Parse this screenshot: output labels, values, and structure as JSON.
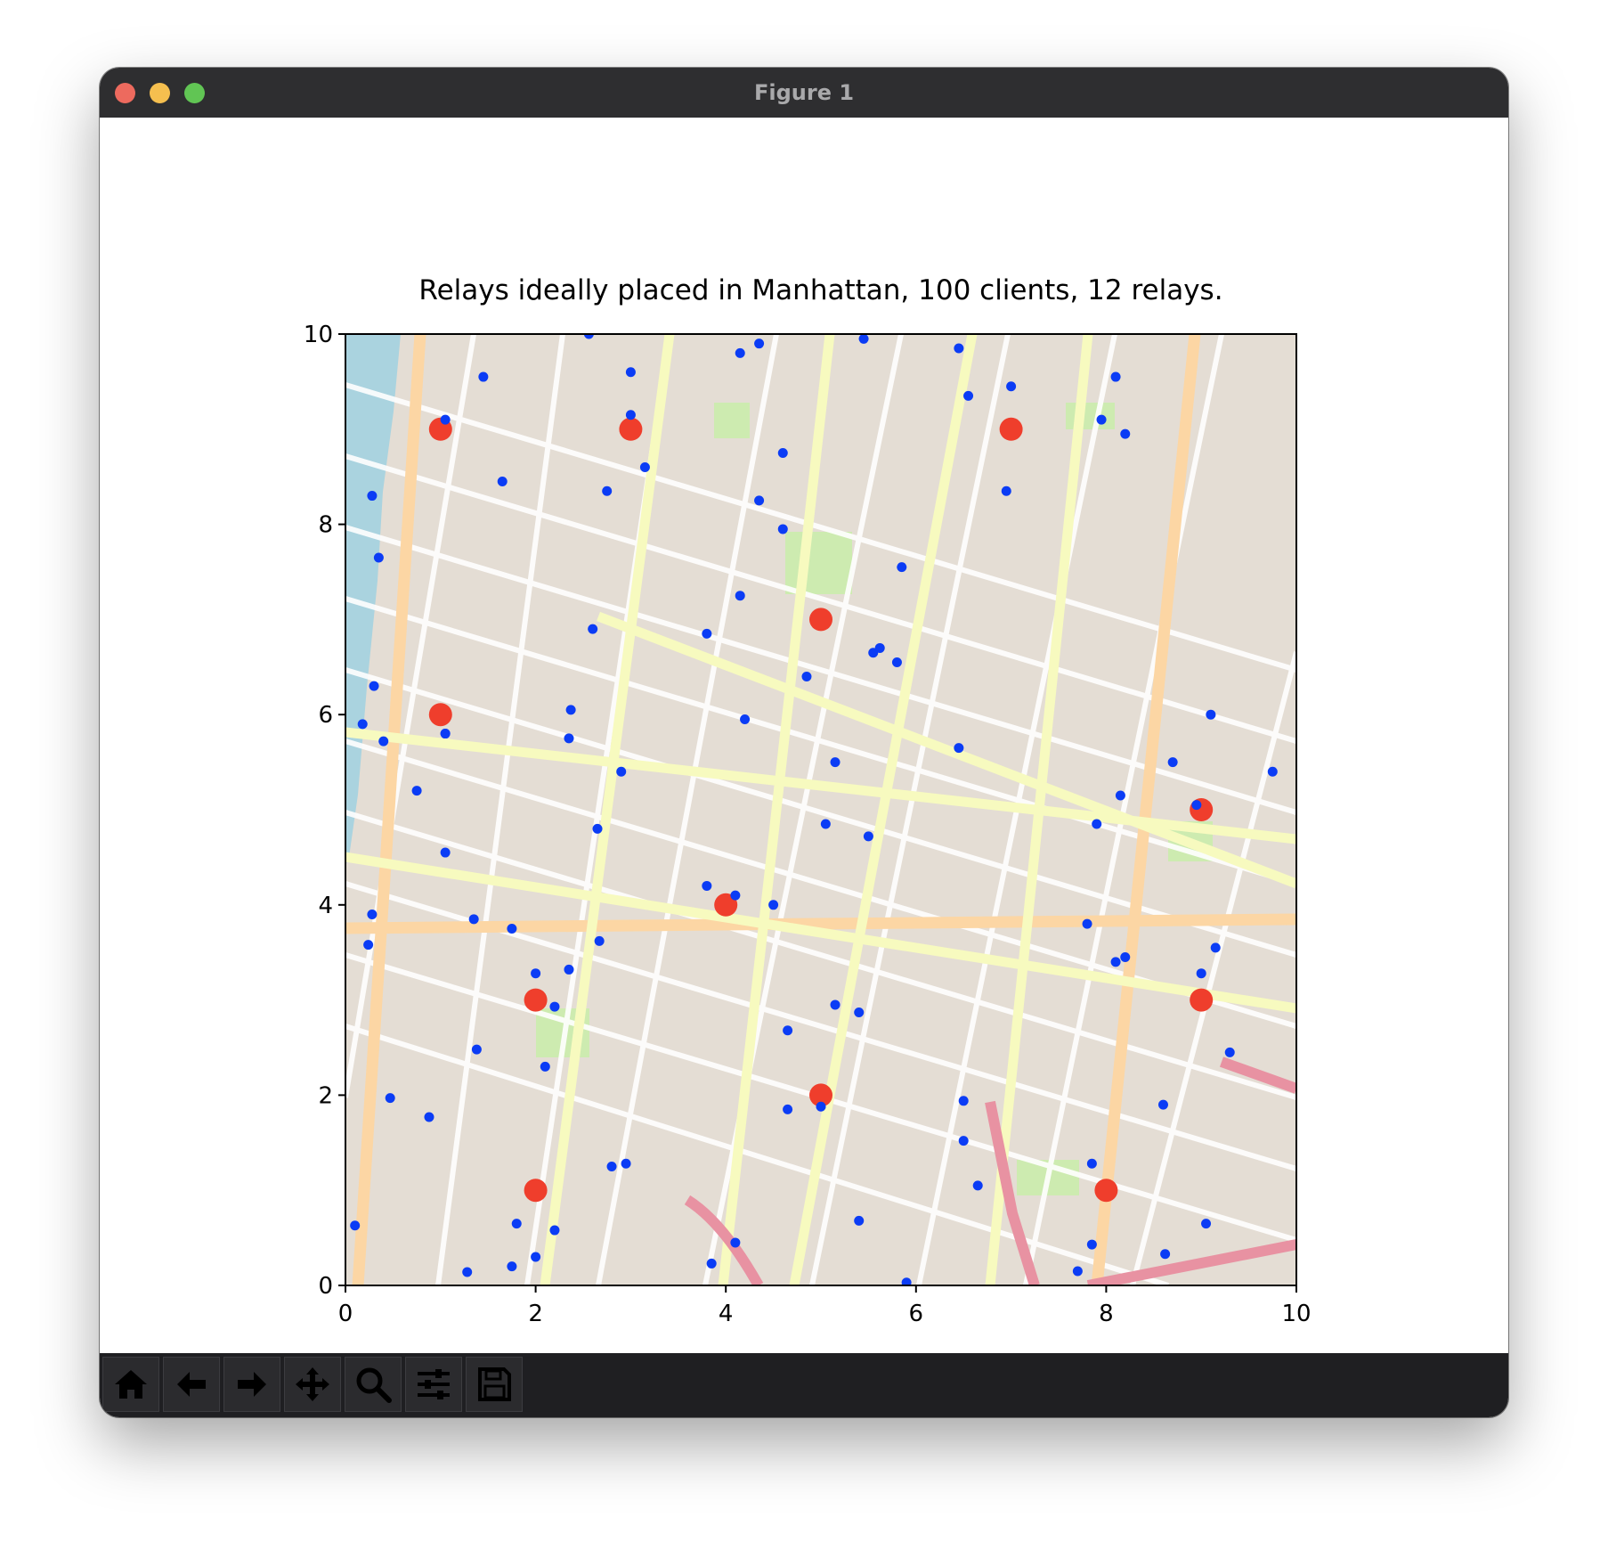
{
  "window": {
    "title": "Figure 1"
  },
  "toolbar": {
    "buttons": [
      {
        "name": "home-button",
        "icon": "home-icon"
      },
      {
        "name": "back-button",
        "icon": "arrow-left-icon"
      },
      {
        "name": "forward-button",
        "icon": "arrow-right-icon"
      },
      {
        "name": "pan-button",
        "icon": "move-icon"
      },
      {
        "name": "zoom-button",
        "icon": "magnifier-icon"
      },
      {
        "name": "configure-subplots-button",
        "icon": "sliders-icon"
      },
      {
        "name": "save-button",
        "icon": "floppy-disk-icon"
      }
    ]
  },
  "chart_data": {
    "type": "scatter",
    "title": "Relays ideally placed in Manhattan, 100 clients, 12 relays.",
    "xlabel": "",
    "ylabel": "",
    "xlim": [
      0,
      10
    ],
    "ylim": [
      0,
      10
    ],
    "xticks": [
      "0",
      "2",
      "4",
      "6",
      "8",
      "10"
    ],
    "yticks": [
      "0",
      "2",
      "4",
      "6",
      "8",
      "10"
    ],
    "grid": false,
    "background": "street map of lower Manhattan",
    "series": [
      {
        "color": "#0b3cf5",
        "marker_size": "small",
        "points": [
          [
            2.56,
            10.0
          ],
          [
            3.0,
            9.6
          ],
          [
            1.45,
            9.55
          ],
          [
            4.15,
            9.8
          ],
          [
            4.35,
            9.9
          ],
          [
            5.45,
            9.95
          ],
          [
            6.45,
            9.85
          ],
          [
            7.0,
            9.45
          ],
          [
            8.1,
            9.55
          ],
          [
            6.55,
            9.35
          ],
          [
            1.05,
            9.1
          ],
          [
            3.0,
            9.15
          ],
          [
            7.95,
            9.1
          ],
          [
            8.2,
            8.95
          ],
          [
            4.6,
            8.75
          ],
          [
            3.15,
            8.6
          ],
          [
            1.65,
            8.45
          ],
          [
            2.75,
            8.35
          ],
          [
            6.95,
            8.35
          ],
          [
            0.28,
            8.3
          ],
          [
            4.35,
            8.25
          ],
          [
            4.6,
            7.95
          ],
          [
            5.85,
            7.55
          ],
          [
            0.35,
            7.65
          ],
          [
            4.15,
            7.25
          ],
          [
            2.6,
            6.9
          ],
          [
            3.8,
            6.85
          ],
          [
            5.55,
            6.65
          ],
          [
            5.62,
            6.7
          ],
          [
            5.8,
            6.55
          ],
          [
            4.85,
            6.4
          ],
          [
            0.3,
            6.3
          ],
          [
            0.18,
            5.9
          ],
          [
            1.05,
            5.8
          ],
          [
            4.2,
            5.95
          ],
          [
            2.37,
            6.05
          ],
          [
            2.35,
            5.75
          ],
          [
            0.4,
            5.72
          ],
          [
            6.45,
            5.65
          ],
          [
            5.15,
            5.5
          ],
          [
            2.9,
            5.4
          ],
          [
            9.1,
            6.0
          ],
          [
            9.75,
            5.4
          ],
          [
            8.7,
            5.5
          ],
          [
            8.15,
            5.15
          ],
          [
            0.75,
            5.2
          ],
          [
            8.95,
            5.05
          ],
          [
            5.05,
            4.85
          ],
          [
            5.5,
            4.72
          ],
          [
            2.65,
            4.8
          ],
          [
            1.05,
            4.55
          ],
          [
            7.9,
            4.85
          ],
          [
            3.8,
            4.2
          ],
          [
            4.1,
            4.1
          ],
          [
            4.5,
            4.0
          ],
          [
            0.28,
            3.9
          ],
          [
            1.35,
            3.85
          ],
          [
            1.75,
            3.75
          ],
          [
            7.8,
            3.8
          ],
          [
            0.24,
            3.58
          ],
          [
            2.67,
            3.62
          ],
          [
            9.15,
            3.55
          ],
          [
            8.1,
            3.4
          ],
          [
            8.2,
            3.45
          ],
          [
            2.0,
            3.28
          ],
          [
            2.35,
            3.32
          ],
          [
            9.0,
            3.28
          ],
          [
            2.2,
            2.93
          ],
          [
            5.15,
            2.95
          ],
          [
            5.4,
            2.87
          ],
          [
            4.65,
            2.68
          ],
          [
            1.38,
            2.48
          ],
          [
            2.1,
            2.3
          ],
          [
            9.3,
            2.45
          ],
          [
            0.47,
            1.97
          ],
          [
            0.88,
            1.77
          ],
          [
            4.65,
            1.85
          ],
          [
            5.0,
            1.88
          ],
          [
            6.5,
            1.94
          ],
          [
            8.6,
            1.9
          ],
          [
            6.5,
            1.52
          ],
          [
            2.8,
            1.25
          ],
          [
            2.95,
            1.28
          ],
          [
            7.85,
            1.28
          ],
          [
            6.65,
            1.05
          ],
          [
            1.8,
            0.65
          ],
          [
            2.2,
            0.58
          ],
          [
            5.4,
            0.68
          ],
          [
            9.05,
            0.65
          ],
          [
            0.1,
            0.63
          ],
          [
            4.1,
            0.45
          ],
          [
            7.85,
            0.43
          ],
          [
            2.0,
            0.3
          ],
          [
            8.62,
            0.33
          ],
          [
            3.85,
            0.23
          ],
          [
            1.75,
            0.2
          ],
          [
            1.28,
            0.14
          ],
          [
            7.7,
            0.15
          ],
          [
            5.9,
            0.03
          ],
          [
            1.05,
            5.8
          ]
        ]
      },
      {
        "color": "#ef3e2c",
        "marker_size": "large",
        "points": [
          [
            1,
            9
          ],
          [
            3,
            9
          ],
          [
            7,
            9
          ],
          [
            5,
            7
          ],
          [
            1,
            6
          ],
          [
            9,
            5
          ],
          [
            4,
            4
          ],
          [
            2,
            3
          ],
          [
            9,
            3
          ],
          [
            5,
            2
          ],
          [
            2,
            1
          ],
          [
            8,
            1
          ]
        ]
      }
    ]
  }
}
